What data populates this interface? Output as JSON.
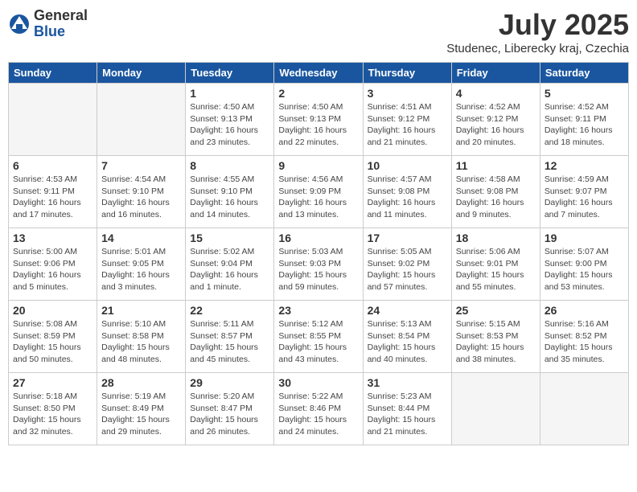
{
  "header": {
    "logo_general": "General",
    "logo_blue": "Blue",
    "month_year": "July 2025",
    "location": "Studenec, Liberecky kraj, Czechia"
  },
  "days_of_week": [
    "Sunday",
    "Monday",
    "Tuesday",
    "Wednesday",
    "Thursday",
    "Friday",
    "Saturday"
  ],
  "weeks": [
    [
      {
        "day": "",
        "info": ""
      },
      {
        "day": "",
        "info": ""
      },
      {
        "day": "1",
        "info": "Sunrise: 4:50 AM\nSunset: 9:13 PM\nDaylight: 16 hours and 23 minutes."
      },
      {
        "day": "2",
        "info": "Sunrise: 4:50 AM\nSunset: 9:13 PM\nDaylight: 16 hours and 22 minutes."
      },
      {
        "day": "3",
        "info": "Sunrise: 4:51 AM\nSunset: 9:12 PM\nDaylight: 16 hours and 21 minutes."
      },
      {
        "day": "4",
        "info": "Sunrise: 4:52 AM\nSunset: 9:12 PM\nDaylight: 16 hours and 20 minutes."
      },
      {
        "day": "5",
        "info": "Sunrise: 4:52 AM\nSunset: 9:11 PM\nDaylight: 16 hours and 18 minutes."
      }
    ],
    [
      {
        "day": "6",
        "info": "Sunrise: 4:53 AM\nSunset: 9:11 PM\nDaylight: 16 hours and 17 minutes."
      },
      {
        "day": "7",
        "info": "Sunrise: 4:54 AM\nSunset: 9:10 PM\nDaylight: 16 hours and 16 minutes."
      },
      {
        "day": "8",
        "info": "Sunrise: 4:55 AM\nSunset: 9:10 PM\nDaylight: 16 hours and 14 minutes."
      },
      {
        "day": "9",
        "info": "Sunrise: 4:56 AM\nSunset: 9:09 PM\nDaylight: 16 hours and 13 minutes."
      },
      {
        "day": "10",
        "info": "Sunrise: 4:57 AM\nSunset: 9:08 PM\nDaylight: 16 hours and 11 minutes."
      },
      {
        "day": "11",
        "info": "Sunrise: 4:58 AM\nSunset: 9:08 PM\nDaylight: 16 hours and 9 minutes."
      },
      {
        "day": "12",
        "info": "Sunrise: 4:59 AM\nSunset: 9:07 PM\nDaylight: 16 hours and 7 minutes."
      }
    ],
    [
      {
        "day": "13",
        "info": "Sunrise: 5:00 AM\nSunset: 9:06 PM\nDaylight: 16 hours and 5 minutes."
      },
      {
        "day": "14",
        "info": "Sunrise: 5:01 AM\nSunset: 9:05 PM\nDaylight: 16 hours and 3 minutes."
      },
      {
        "day": "15",
        "info": "Sunrise: 5:02 AM\nSunset: 9:04 PM\nDaylight: 16 hours and 1 minute."
      },
      {
        "day": "16",
        "info": "Sunrise: 5:03 AM\nSunset: 9:03 PM\nDaylight: 15 hours and 59 minutes."
      },
      {
        "day": "17",
        "info": "Sunrise: 5:05 AM\nSunset: 9:02 PM\nDaylight: 15 hours and 57 minutes."
      },
      {
        "day": "18",
        "info": "Sunrise: 5:06 AM\nSunset: 9:01 PM\nDaylight: 15 hours and 55 minutes."
      },
      {
        "day": "19",
        "info": "Sunrise: 5:07 AM\nSunset: 9:00 PM\nDaylight: 15 hours and 53 minutes."
      }
    ],
    [
      {
        "day": "20",
        "info": "Sunrise: 5:08 AM\nSunset: 8:59 PM\nDaylight: 15 hours and 50 minutes."
      },
      {
        "day": "21",
        "info": "Sunrise: 5:10 AM\nSunset: 8:58 PM\nDaylight: 15 hours and 48 minutes."
      },
      {
        "day": "22",
        "info": "Sunrise: 5:11 AM\nSunset: 8:57 PM\nDaylight: 15 hours and 45 minutes."
      },
      {
        "day": "23",
        "info": "Sunrise: 5:12 AM\nSunset: 8:55 PM\nDaylight: 15 hours and 43 minutes."
      },
      {
        "day": "24",
        "info": "Sunrise: 5:13 AM\nSunset: 8:54 PM\nDaylight: 15 hours and 40 minutes."
      },
      {
        "day": "25",
        "info": "Sunrise: 5:15 AM\nSunset: 8:53 PM\nDaylight: 15 hours and 38 minutes."
      },
      {
        "day": "26",
        "info": "Sunrise: 5:16 AM\nSunset: 8:52 PM\nDaylight: 15 hours and 35 minutes."
      }
    ],
    [
      {
        "day": "27",
        "info": "Sunrise: 5:18 AM\nSunset: 8:50 PM\nDaylight: 15 hours and 32 minutes."
      },
      {
        "day": "28",
        "info": "Sunrise: 5:19 AM\nSunset: 8:49 PM\nDaylight: 15 hours and 29 minutes."
      },
      {
        "day": "29",
        "info": "Sunrise: 5:20 AM\nSunset: 8:47 PM\nDaylight: 15 hours and 26 minutes."
      },
      {
        "day": "30",
        "info": "Sunrise: 5:22 AM\nSunset: 8:46 PM\nDaylight: 15 hours and 24 minutes."
      },
      {
        "day": "31",
        "info": "Sunrise: 5:23 AM\nSunset: 8:44 PM\nDaylight: 15 hours and 21 minutes."
      },
      {
        "day": "",
        "info": ""
      },
      {
        "day": "",
        "info": ""
      }
    ]
  ]
}
